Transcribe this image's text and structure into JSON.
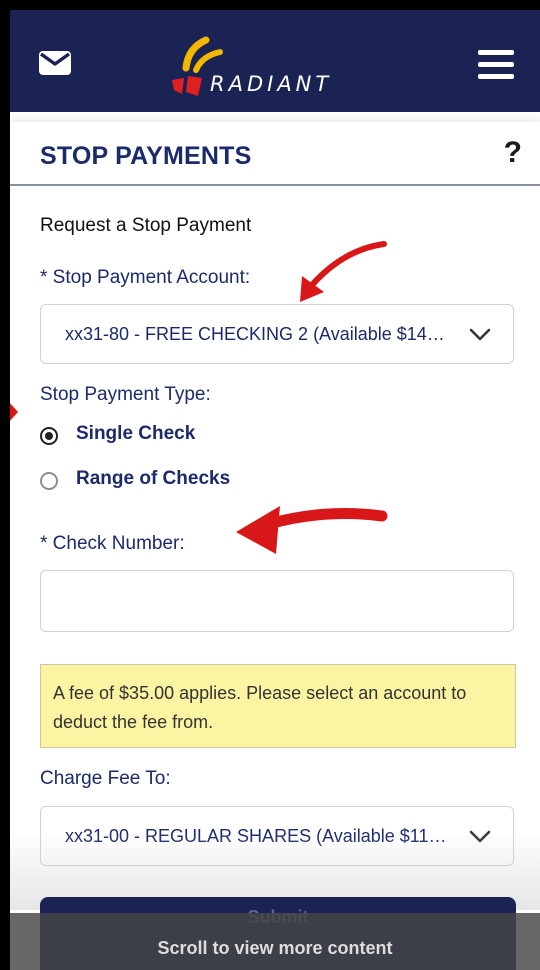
{
  "brand": {
    "name": "RADIANT",
    "navy": "#1b2355",
    "title_blue": "#1b2a6b",
    "logo_yellow": "#f5b800",
    "logo_red": "#e02020",
    "notice_yellow": "#fbf4a3"
  },
  "topbar": {
    "mail_icon": "envelope-icon",
    "menu_icon": "hamburger-menu-icon"
  },
  "header": {
    "title": "STOP PAYMENTS",
    "help": "?"
  },
  "form": {
    "section_title": "Request a Stop Payment",
    "account_label": "* Stop Payment Account:",
    "account_value": "xx31-80 - FREE CHECKING 2 (Available $14…",
    "type_label": "Stop Payment Type:",
    "type_options": [
      {
        "label": "Single Check",
        "selected": true
      },
      {
        "label": "Range of Checks",
        "selected": false
      }
    ],
    "check_number_label": "* Check Number:",
    "check_number_value": "",
    "fee_notice": "A fee of $35.00 applies. Please select an account to deduct the fee from.",
    "charge_fee_label": "Charge Fee To:",
    "charge_fee_value": "xx31-00 - REGULAR SHARES (Available $11…",
    "submit_label": "Submit"
  },
  "scroll_hint": "Scroll to view more content"
}
